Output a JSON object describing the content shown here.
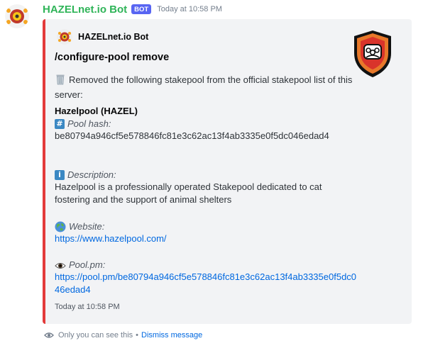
{
  "message": {
    "username": "HAZELnet.io Bot",
    "badge": "BOT",
    "timestamp": "Today at 10:58 PM"
  },
  "embed": {
    "accent_color": "#e33a3a",
    "author": "HAZELnet.io Bot",
    "title": "/configure-pool remove",
    "description": "Removed the following stakepool from the official stakepool list of this server:",
    "pool_name": "Hazelpool (HAZEL)",
    "fields": [
      {
        "icon": "#",
        "name": "Pool hash:",
        "value": "be80794a946cf5e578846fc81e3c62ac13f4ab3335e0f5dc046edad4"
      },
      {
        "icon": "i",
        "name": "Description:",
        "value": "Hazelpool is a professionally operated Stakepool dedicated to cat fostering and the support of animal shelters"
      },
      {
        "icon": "globe",
        "name": "Website:",
        "value": "https://www.hazelpool.com/"
      },
      {
        "icon": "eye",
        "name": "Pool.pm:",
        "value": "https://pool.pm/be80794a946cf5e578846fc81e3c62ac13f4ab3335e0f5dc046edad4"
      }
    ],
    "footer_time": "Today at 10:58 PM"
  },
  "ephemeral": {
    "notice": "Only you can see this",
    "separator": "•",
    "dismiss": "Dismiss message"
  }
}
